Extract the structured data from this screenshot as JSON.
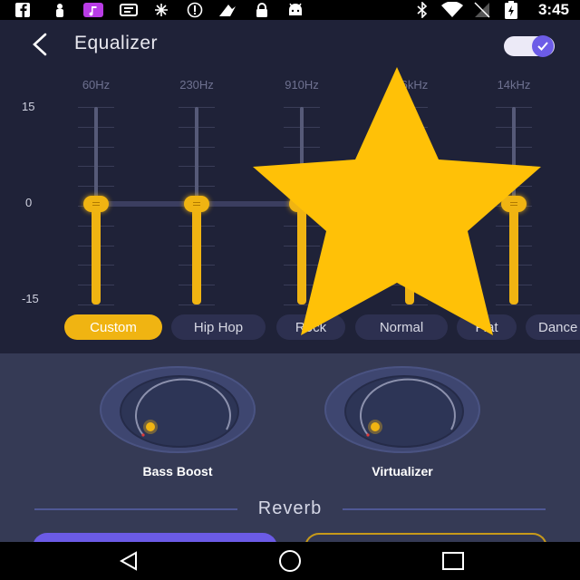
{
  "status_bar": {
    "time": "3:45",
    "icons": [
      "facebook-icon",
      "gym-icon",
      "music-icon",
      "chat-icon",
      "sync-icon",
      "alert-icon",
      "fair-icon",
      "lock-icon",
      "android-icon",
      "bluetooth-icon",
      "wifi-icon",
      "no-signal-icon",
      "battery-charging-icon"
    ]
  },
  "header": {
    "title": "Equalizer",
    "toggle_on": true
  },
  "equalizer": {
    "frequencies": [
      "60Hz",
      "230Hz",
      "910Hz",
      "3.6kHz",
      "14kHz"
    ],
    "db_labels": {
      "top": "15",
      "middle": "0",
      "bottom": "-15"
    },
    "band_gains_db": [
      0,
      0,
      0,
      -2,
      0
    ],
    "accent": "#f0b412"
  },
  "presets": [
    {
      "label": "Custom",
      "active": true
    },
    {
      "label": "Hip Hop",
      "active": false
    },
    {
      "label": "Rock",
      "active": false
    },
    {
      "label": "Normal",
      "active": false
    },
    {
      "label": "Flat",
      "active": false
    },
    {
      "label": "Dance",
      "active": false
    }
  ],
  "effects": {
    "bass_boost_label": "Bass Boost",
    "virtualizer_label": "Virtualizer",
    "reverb_label": "Reverb"
  },
  "overlay": {
    "shape": "star-icon",
    "color": "#ffc107"
  },
  "colors": {
    "background": "#1f2238",
    "panel": "#353a55",
    "accent": "#f0b412",
    "toggle": "#6c5ce7"
  }
}
